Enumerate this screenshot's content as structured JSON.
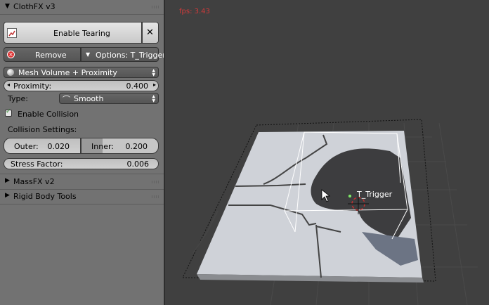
{
  "panel": {
    "clothfx": {
      "title": "ClothFX v3",
      "enable_tearing_label": "Enable Tearing",
      "remove_label": "Remove",
      "options_label": "Options: T_Trigger",
      "mode_value": "Mesh Volume + Proximity",
      "proximity_label": "Proximity:",
      "proximity_value": "0.400",
      "type_label": "Type:",
      "type_value": "Smooth",
      "enable_collision_label": "Enable Collision",
      "enable_collision_checked": true,
      "collision_settings_label": "Collision Settings:",
      "outer_label": "Outer:",
      "outer_value": "0.020",
      "inner_label": "Inner:",
      "inner_value": "0.200",
      "stress_label": "Stress Factor:",
      "stress_value": "0.006"
    },
    "sections": [
      {
        "title": "MassFX v2"
      },
      {
        "title": "Rigid Body Tools"
      }
    ]
  },
  "viewport": {
    "fps_text": "fps: 3.43",
    "object_label": "T_Trigger",
    "fps_color": "#d03a3a"
  },
  "icons": {
    "collapse": "triangle-down-icon",
    "expand": "triangle-right-icon",
    "close": "close-icon",
    "remove": "remove-icon",
    "mesh": "mesh-sphere-icon",
    "curve": "smooth-curve-icon",
    "tear": "tearing-icon"
  }
}
